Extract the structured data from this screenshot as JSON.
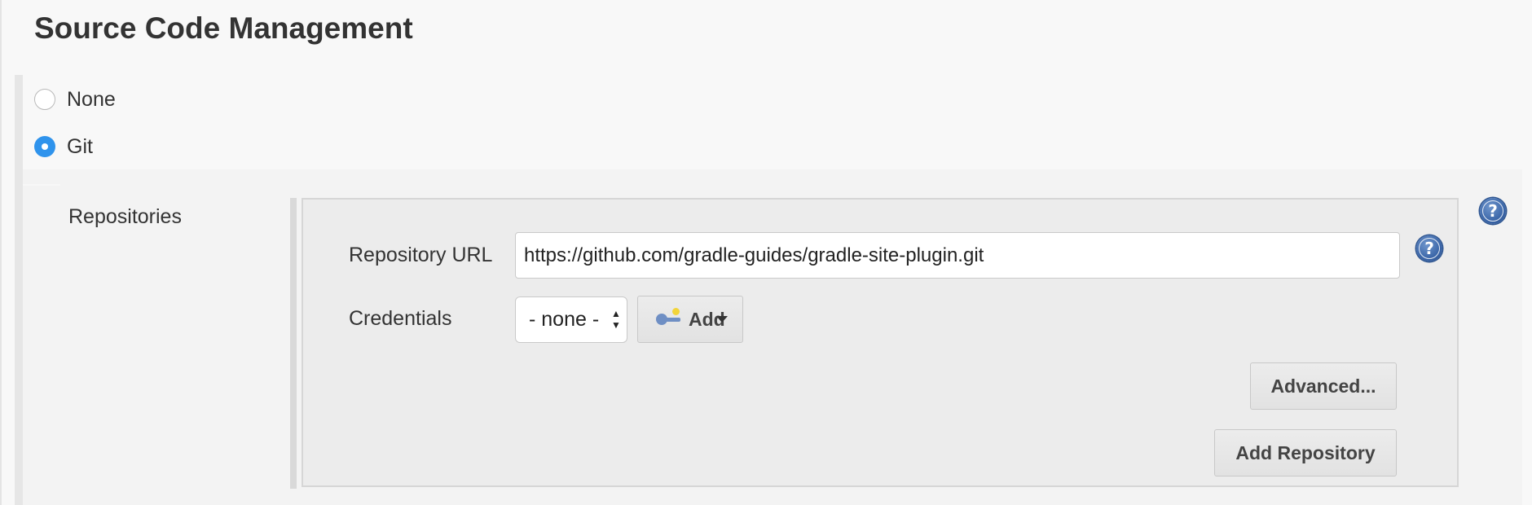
{
  "section": {
    "title": "Source Code Management"
  },
  "scm_options": [
    {
      "label": "None",
      "checked": false
    },
    {
      "label": "Git",
      "checked": true
    }
  ],
  "git": {
    "repositories_label": "Repositories",
    "repository_url_label": "Repository URL",
    "repository_url_value": "https://github.com/gradle-guides/gradle-site-plugin.git",
    "credentials_label": "Credentials",
    "credentials_selected": "- none -",
    "add_label": "Add",
    "advanced_label": "Advanced...",
    "add_repository_label": "Add Repository",
    "help_glyph": "?"
  },
  "icons": {
    "help": "help-question-icon",
    "key": "key-icon",
    "dropdown": "chevron-down-icon"
  },
  "colors": {
    "accent_radio": "#2f93ec",
    "help_icon": "#3b66a8",
    "page_bg": "#f8f8f8",
    "panel_bg": "#ececec"
  }
}
